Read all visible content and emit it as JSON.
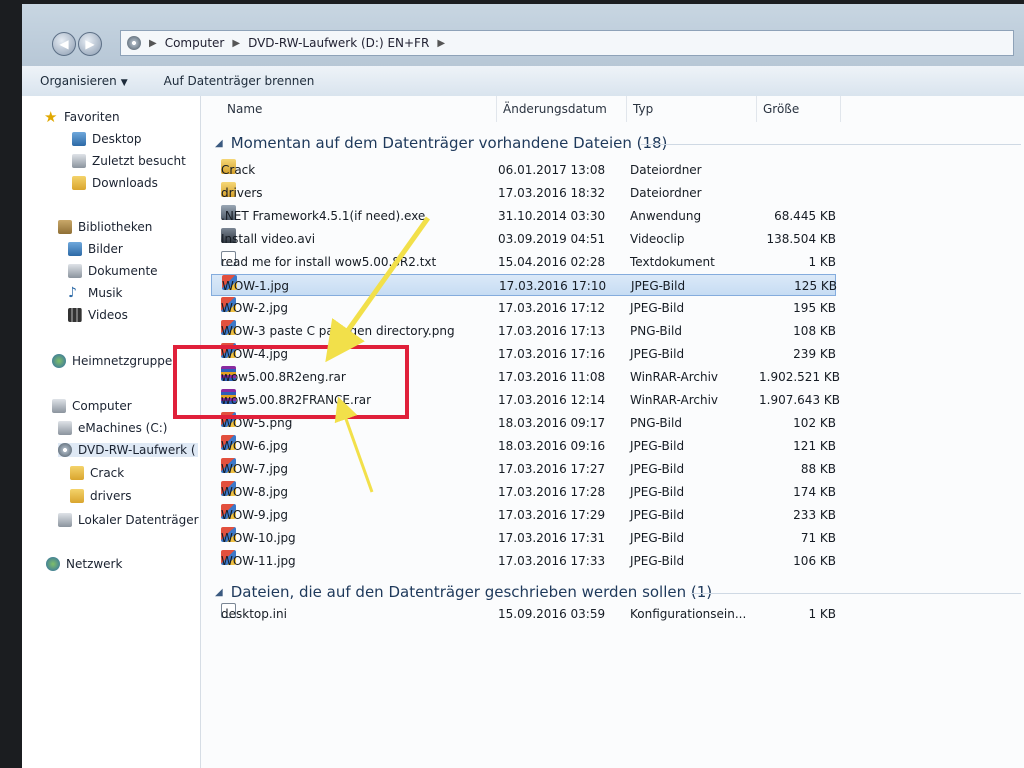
{
  "address": {
    "back": "◀",
    "forward": "▶",
    "crumbs": [
      "Computer",
      "DVD-RW-Laufwerk (D:) EN+FR"
    ]
  },
  "toolbar": {
    "organize": "Organisieren",
    "burn": "Auf Datenträger brennen"
  },
  "nav": {
    "favorites": "Favoriten",
    "desktop": "Desktop",
    "recent": "Zuletzt besucht",
    "downloads": "Downloads",
    "libraries": "Bibliotheken",
    "pictures": "Bilder",
    "documents": "Dokumente",
    "music": "Musik",
    "videos": "Videos",
    "homegroup": "Heimnetzgruppe",
    "computer": "Computer",
    "c_drive": "eMachines (C:)",
    "dvd_drive": "DVD-RW-Laufwerk (",
    "crack": "Crack",
    "drivers": "drivers",
    "local_disk": "Lokaler Datenträger",
    "network": "Netzwerk"
  },
  "columns": {
    "name": "Name",
    "date": "Änderungsdatum",
    "type": "Typ",
    "size": "Größe"
  },
  "group1": {
    "title": "Momentan auf dem Datenträger vorhandene Dateien (18)",
    "files": [
      {
        "name": "Crack",
        "date": "06.01.2017 13:08",
        "type": "Dateiordner",
        "size": "",
        "icon": "folder-icon"
      },
      {
        "name": "drivers",
        "date": "17.03.2016 18:32",
        "type": "Dateiordner",
        "size": "",
        "icon": "folder-icon"
      },
      {
        "name": ".NET Framework4.5.1(if need).exe",
        "date": "31.10.2014 03:30",
        "type": "Anwendung",
        "size": "68.445 KB",
        "icon": "exe-icon"
      },
      {
        "name": "Install video.avi",
        "date": "03.09.2019 04:51",
        "type": "Videoclip",
        "size": "138.504 KB",
        "icon": "video-icon"
      },
      {
        "name": "read me for install wow5.00.8R2.txt",
        "date": "15.04.2016 02:28",
        "type": "Textdokument",
        "size": "1 KB",
        "icon": "text-file-icon"
      },
      {
        "name": "WOW-1.jpg",
        "date": "17.03.2016 17:10",
        "type": "JPEG-Bild",
        "size": "125 KB",
        "icon": "image-icon",
        "selected": true
      },
      {
        "name": "WOW-2.jpg",
        "date": "17.03.2016 17:12",
        "type": "JPEG-Bild",
        "size": "195 KB",
        "icon": "image-icon"
      },
      {
        "name": "WOW-3 paste C pa...-gen directory.png",
        "date": "17.03.2016 17:13",
        "type": "PNG-Bild",
        "size": "108 KB",
        "icon": "image-icon"
      },
      {
        "name": "WOW-4.jpg",
        "date": "17.03.2016 17:16",
        "type": "JPEG-Bild",
        "size": "239 KB",
        "icon": "image-icon"
      },
      {
        "name": "wow5.00.8R2eng.rar",
        "date": "17.03.2016 11:08",
        "type": "WinRAR-Archiv",
        "size": "1.902.521 KB",
        "icon": "rar-icon"
      },
      {
        "name": "wow5.00.8R2FRANCE.rar",
        "date": "17.03.2016 12:14",
        "type": "WinRAR-Archiv",
        "size": "1.907.643 KB",
        "icon": "rar-icon"
      },
      {
        "name": "WOW-5.png",
        "date": "18.03.2016 09:17",
        "type": "PNG-Bild",
        "size": "102 KB",
        "icon": "image-icon"
      },
      {
        "name": "WOW-6.jpg",
        "date": "18.03.2016 09:16",
        "type": "JPEG-Bild",
        "size": "121 KB",
        "icon": "image-icon"
      },
      {
        "name": "WOW-7.jpg",
        "date": "17.03.2016 17:27",
        "type": "JPEG-Bild",
        "size": "88 KB",
        "icon": "image-icon"
      },
      {
        "name": "WOW-8.jpg",
        "date": "17.03.2016 17:28",
        "type": "JPEG-Bild",
        "size": "174 KB",
        "icon": "image-icon"
      },
      {
        "name": "WOW-9.jpg",
        "date": "17.03.2016 17:29",
        "type": "JPEG-Bild",
        "size": "233 KB",
        "icon": "image-icon"
      },
      {
        "name": "WOW-10.jpg",
        "date": "17.03.2016 17:31",
        "type": "JPEG-Bild",
        "size": "71 KB",
        "icon": "image-icon"
      },
      {
        "name": "WOW-11.jpg",
        "date": "17.03.2016 17:33",
        "type": "JPEG-Bild",
        "size": "106 KB",
        "icon": "image-icon"
      }
    ]
  },
  "group2": {
    "title": "Dateien, die auf den Datenträger geschrieben werden sollen (1)",
    "files": [
      {
        "name": "desktop.ini",
        "date": "15.09.2016 03:59",
        "type": "Konfigurationsein...",
        "size": "1 KB",
        "icon": "ini-file-icon"
      }
    ]
  },
  "annotation": {
    "highlight_color": "#e0203a",
    "arrow_color": "#f2e04a"
  }
}
